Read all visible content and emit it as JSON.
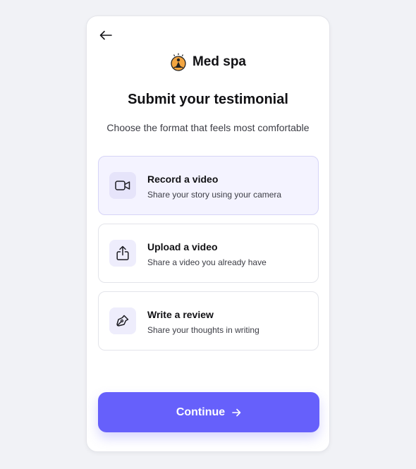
{
  "header": {
    "back_icon": "arrow-left-icon",
    "brand_logo_icon": "meditation-logo-icon",
    "brand_name": "Med spa"
  },
  "title": "Submit your testimonial",
  "subtitle": "Choose the format that feels most comfortable",
  "options": [
    {
      "title": "Record a video",
      "description": "Share your story using your camera",
      "icon": "video-camera-icon",
      "selected": true
    },
    {
      "title": "Upload a video",
      "description": "Share a video you already have",
      "icon": "upload-icon",
      "selected": false
    },
    {
      "title": "Write a review",
      "description": "Share your thoughts in writing",
      "icon": "pen-icon",
      "selected": false
    }
  ],
  "continue_label": "Continue",
  "continue_icon": "arrow-right-icon",
  "colors": {
    "accent": "#6660fb",
    "selected_bg": "#f4f3ff",
    "icon_bg": "#eeedfc",
    "page_bg": "#f1f2f6"
  }
}
